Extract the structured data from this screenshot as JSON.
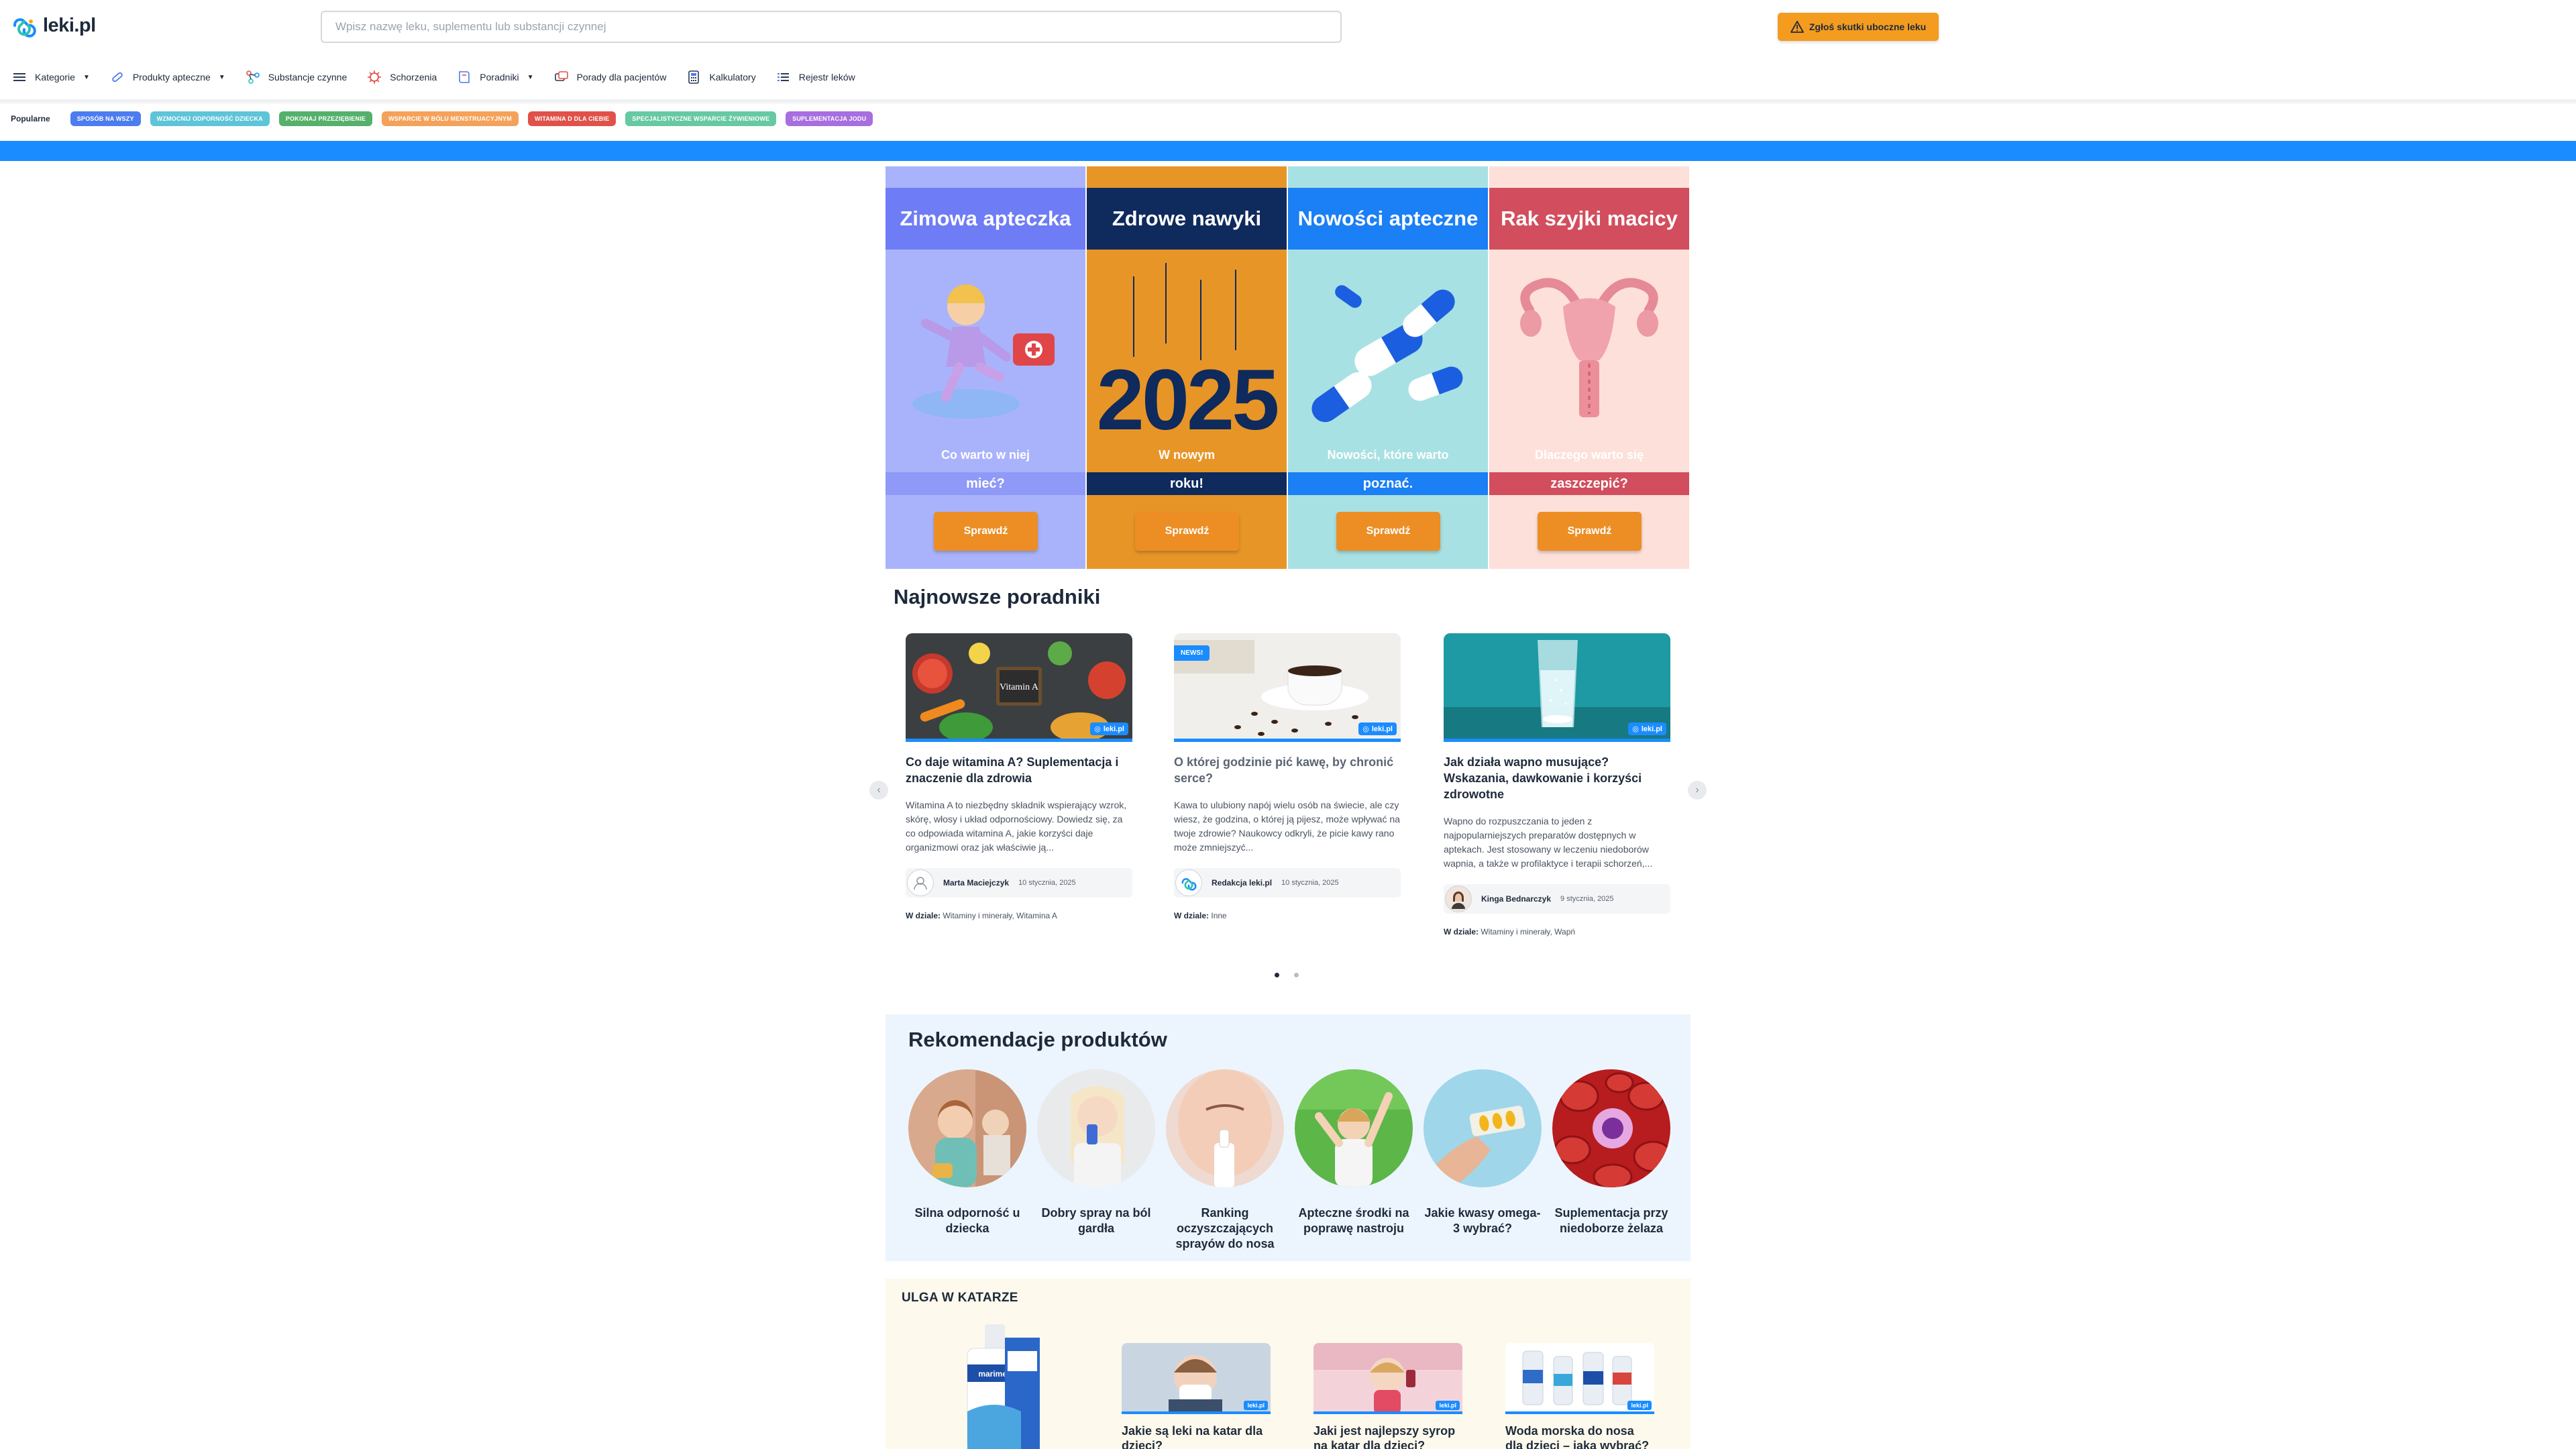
{
  "header": {
    "logo_text": "leki.pl",
    "search_placeholder": "Wpisz nazwę leku, suplementu lub substancji czynnej",
    "report_label": "Zgłoś skutki uboczne leku"
  },
  "nav": {
    "items": [
      {
        "label": "Kategorie",
        "icon": "menu-icon",
        "dropdown": true
      },
      {
        "label": "Produkty apteczne",
        "icon": "pill-icon",
        "dropdown": true
      },
      {
        "label": "Substancje czynne",
        "icon": "molecule-icon",
        "dropdown": false
      },
      {
        "label": "Schorzenia",
        "icon": "virus-icon",
        "dropdown": false
      },
      {
        "label": "Poradniki",
        "icon": "book-icon",
        "dropdown": true
      },
      {
        "label": "Porady dla pacjentów",
        "icon": "chat-icon",
        "dropdown": false
      },
      {
        "label": "Kalkulatory",
        "icon": "calculator-icon",
        "dropdown": false
      },
      {
        "label": "Rejestr leków",
        "icon": "list-icon",
        "dropdown": false
      }
    ]
  },
  "popular": {
    "label": "Popularne",
    "tags": [
      {
        "label": "Sposób na wszy",
        "color": "#4c7cf0"
      },
      {
        "label": "Wzmocnij odporność dziecka",
        "color": "#5ec4d8"
      },
      {
        "label": "Pokonaj przeziębienie",
        "color": "#54b06a"
      },
      {
        "label": "Wsparcie w bólu menstruacyjnym",
        "color": "#f4a259"
      },
      {
        "label": "Witamina D dla ciebie",
        "color": "#e0514a"
      },
      {
        "label": "Specjalistyczne wsparcie żywieniowe",
        "color": "#67c9a2"
      },
      {
        "label": "Suplementacja jodu",
        "color": "#a76ee0"
      }
    ]
  },
  "promos": [
    {
      "title": "Zimowa apteczka",
      "sub1": "Co warto w niej",
      "sub2": "mieć?",
      "button": "Sprawdź",
      "bg": "#a9b3fb",
      "title_bg": "#6e7cf5",
      "sub2_bg": "#8f99f7"
    },
    {
      "title": "Zdrowe nawyki",
      "sub1": "W nowym",
      "sub2": "roku!",
      "button": "Sprawdź",
      "bg": "#e89527",
      "title_bg": "#0f2a5c",
      "sub2_bg": "#0f2a5c",
      "year": "2025"
    },
    {
      "title": "Nowości apteczne",
      "sub1": "Nowości, które warto",
      "sub2": "poznać.",
      "button": "Sprawdź",
      "bg": "#a8e1e3",
      "title_bg": "#1b7ff5",
      "sub2_bg": "#1b7ff5"
    },
    {
      "title": "Rak szyjki macicy",
      "sub1": "Dlaczego warto się",
      "sub2": "zaszczepić?",
      "button": "Sprawdź",
      "bg": "#fde0da",
      "title_bg": "#d24e5e",
      "sub2_bg": "#d24e5e"
    }
  ],
  "guides": {
    "title": "Najnowsze poradniki",
    "cat_label": "W dziale:",
    "items": [
      {
        "title": "Co daje witamina A? Suplementacja i znaczenie dla zdrowia",
        "desc": "Witamina A to niezbędny składnik wspierający wzrok, skórę, włosy i układ odpornościowy. Dowiedz się, za co odpowiada witamina A, jakie korzyści daje organizmowi oraz jak właściwie ją...",
        "author": "Marta Maciejczyk",
        "date": "10 stycznia, 2025",
        "category": "Witaminy i minerały, Witamina A",
        "badge": "leki.pl",
        "img_label": "Vitamin A"
      },
      {
        "title": "O której godzinie pić kawę, by chronić serce?",
        "desc": "Kawa to ulubiony napój wielu osób na świecie, ale czy wiesz, że godzina, o której ją pijesz, może wpływać na twoje zdrowie? Naukowcy odkryli, że picie kawy rano może zmniejszyć...",
        "author": "Redakcja leki.pl",
        "date": "10 stycznia, 2025",
        "category": "Inne",
        "badge": "leki.pl",
        "news": "NEWS!"
      },
      {
        "title": "Jak działa wapno musujące? Wskazania, dawkowanie i korzyści zdrowotne",
        "desc": "Wapno do rozpuszczania to jeden z najpopularniejszych preparatów dostępnych w aptekach. Jest stosowany w leczeniu niedoborów wapnia, a także w profilaktyce i terapii schorzeń,...",
        "author": "Kinga Bednarczyk",
        "date": "9 stycznia, 2025",
        "category": "Witaminy i minerały, Wapń",
        "badge": "leki.pl"
      }
    ]
  },
  "reco": {
    "title": "Rekomendacje produktów",
    "items": [
      {
        "label": "Silna odporność u dziecka"
      },
      {
        "label": "Dobry spray na ból gardła"
      },
      {
        "label": "Ranking oczyszczających sprayów do nosa"
      },
      {
        "label": "Apteczne środki na poprawę nastroju"
      },
      {
        "label": "Jakie kwasy omega-3 wybrać?"
      },
      {
        "label": "Suplementacja przy niedoborze żelaza"
      }
    ]
  },
  "ulga": {
    "title": "ULGA W KATARZE",
    "product_label": "marimer",
    "badge": "leki.pl",
    "cards": [
      {
        "label": "Jakie są leki na katar dla dzieci?"
      },
      {
        "label": "Jaki jest najlepszy syrop na katar dla dzieci?"
      },
      {
        "label": "Woda morska do nosa dla dzieci – jaką wybrać?"
      }
    ]
  }
}
